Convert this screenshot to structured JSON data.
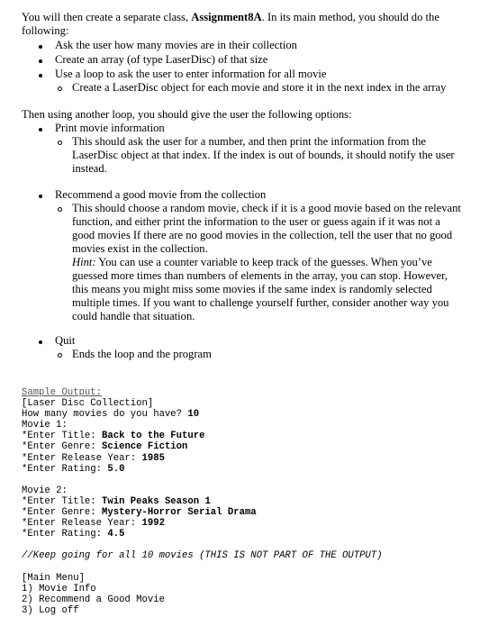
{
  "intro": {
    "before": "You will then create a separate class, ",
    "class_name": "Assignment8A",
    "after": ". In its main method, you should do the following:"
  },
  "setup_steps": [
    "Ask the user how many movies are in their collection",
    "Create an array (of type LaserDisc) of that size",
    "Use a loop to ask the user to enter information for all movie"
  ],
  "setup_substep": "Create a LaserDisc object for each movie and store it in the next index in the array",
  "options_intro": "Then using another loop, you should give the user the following options:",
  "options": [
    {
      "label": "Print movie information",
      "detail": "This should ask the user for a number, and then print the information from the LaserDisc object at that index. If the index is out of bounds, it should notify the user instead."
    },
    {
      "label": "Recommend a good movie from the collection",
      "detail": "This should choose a random movie, check if it is a good movie based on the relevant function, and either print the information to the user or guess again if it was not a good movies If there are no good movies in the collection, tell the user that no good movies exist in the collection.",
      "hint_label": "Hint:",
      "hint_text": " You can use a counter variable to keep track of the guesses. When you’ve guessed more times than numbers of elements in the array, you can stop. However, this means you might miss some movies if the same index is randomly selected multiple times. If you want to challenge yourself further, consider another way you could handle that situation."
    },
    {
      "label": "Quit",
      "detail": "Ends the loop and the program"
    }
  ],
  "sample_output": {
    "heading": "Sample Output:",
    "collection_header": "[Laser Disc Collection]",
    "count_prompt": "How many movies do you have? ",
    "count_value": "10",
    "movies": [
      {
        "header": "Movie 1:",
        "title_prompt": "*Enter Title: ",
        "title": "Back to the Future",
        "genre_prompt": "*Enter Genre: ",
        "genre": "Science Fiction",
        "year_prompt": "*Enter Release Year: ",
        "year": "1985",
        "rating_prompt": "*Enter Rating: ",
        "rating": "5.0"
      },
      {
        "header": "Movie 2:",
        "title_prompt": "*Enter Title: ",
        "title": "Twin Peaks Season 1",
        "genre_prompt": "*Enter Genre: ",
        "genre": "Mystery-Horror Serial Drama",
        "year_prompt": "*Enter Release Year: ",
        "year": "1992",
        "rating_prompt": "*Enter Rating: ",
        "rating": "4.5"
      }
    ],
    "comment": "//Keep going for all 10 movies (THIS IS NOT PART OF THE OUTPUT)",
    "menu_header": "[Main Menu]",
    "menu_items": [
      "1) Movie Info",
      "2) Recommend a Good Movie",
      "3) Log off"
    ]
  }
}
